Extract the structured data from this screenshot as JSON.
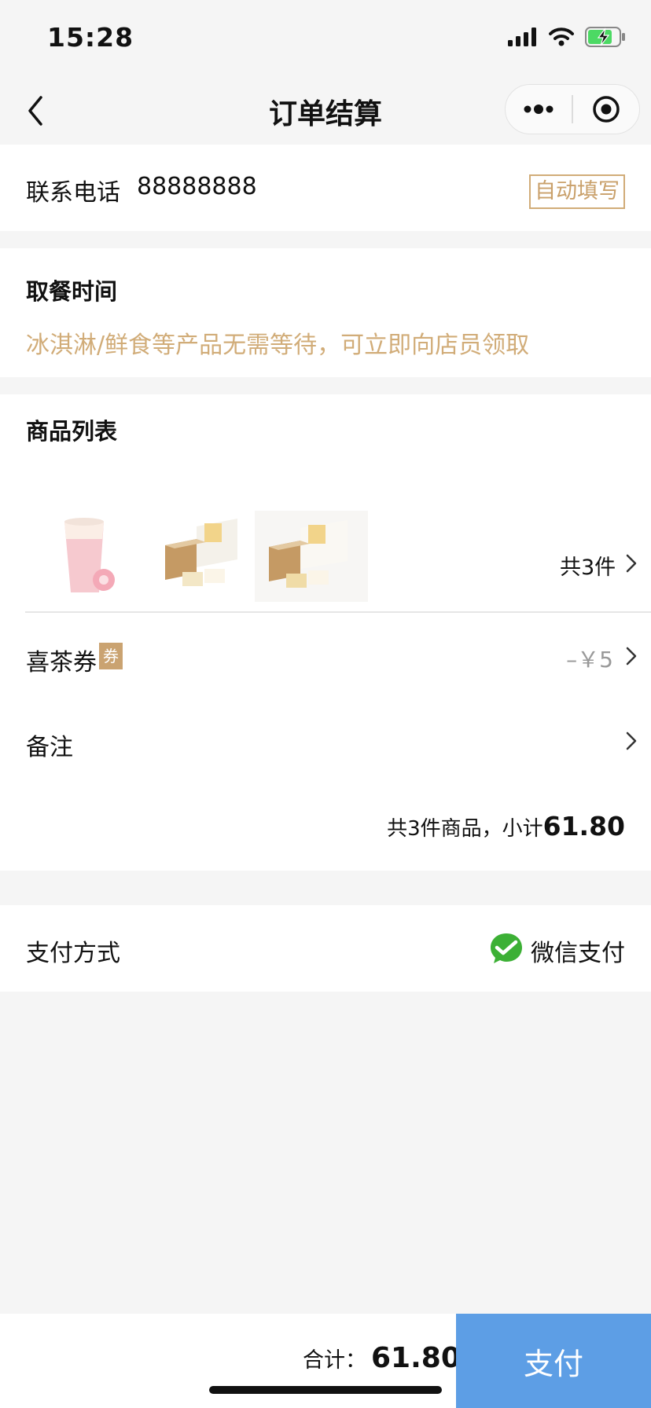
{
  "status_bar": {
    "time": "15:28"
  },
  "nav": {
    "title": "订单结算"
  },
  "contact": {
    "label": "联系电话",
    "phone": "88888888",
    "auto_fill_label": "自动填写"
  },
  "pickup": {
    "title": "取餐时间",
    "notice": "冰淇淋/鲜食等产品无需等待，可立即向店员领取"
  },
  "products": {
    "title": "商品列表",
    "count_label": "共3件"
  },
  "coupon": {
    "label": "喜茶券",
    "badge": "券",
    "value": "–￥5"
  },
  "remarks": {
    "label": "备注"
  },
  "subtotal": {
    "prefix": "共3件商品，小计",
    "amount": "61.80"
  },
  "payment": {
    "label": "支付方式",
    "method": "微信支付"
  },
  "bottom": {
    "total_label": "合计：",
    "total_amount": "61.80",
    "pay_button": "支付"
  },
  "colors": {
    "accent": "#d1ac78",
    "pay_button": "#5d9ee5",
    "wechat_green": "#3cb035"
  }
}
